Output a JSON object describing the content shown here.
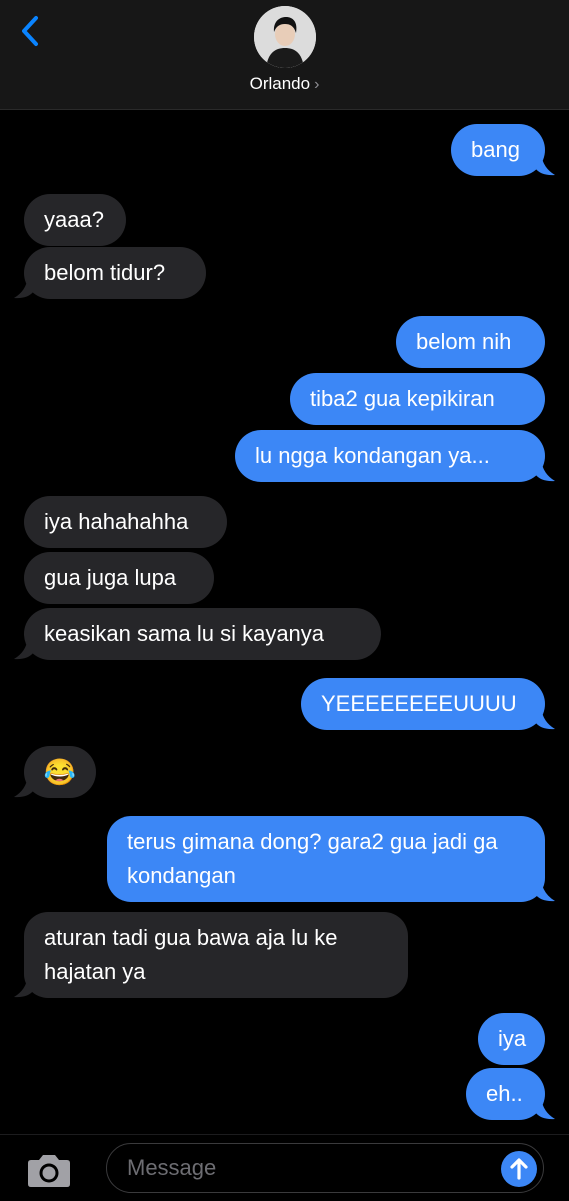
{
  "contact": {
    "name": "Orlando",
    "chevron": "›"
  },
  "messages": [
    {
      "from": "me",
      "text": "bang"
    },
    {
      "from": "them",
      "text": "yaaa?"
    },
    {
      "from": "them",
      "text": "belom tidur?"
    },
    {
      "from": "me",
      "text": "belom nih"
    },
    {
      "from": "me",
      "text": "tiba2 gua kepikiran"
    },
    {
      "from": "me",
      "text": "lu ngga kondangan ya..."
    },
    {
      "from": "them",
      "text": "iya hahahahha"
    },
    {
      "from": "them",
      "text": "gua juga lupa"
    },
    {
      "from": "them",
      "text": "keasikan sama lu si kayanya"
    },
    {
      "from": "me",
      "text": "YEEEEEEEEUUUU"
    },
    {
      "from": "them",
      "text": "😂"
    },
    {
      "from": "me",
      "text": "terus gimana dong? gara2 gua jadi ga kondangan"
    },
    {
      "from": "them",
      "text": "aturan tadi gua bawa aja lu ke hajatan ya"
    },
    {
      "from": "me",
      "text": "iya"
    },
    {
      "from": "me",
      "text": "eh.."
    }
  ],
  "composer": {
    "placeholder": "Message"
  },
  "icons": {
    "back": "back-chevron-icon",
    "camera": "camera-icon",
    "send": "send-arrow-icon"
  },
  "colors": {
    "sent": "#3c87f6",
    "received": "#262629",
    "accent": "#0a84ff"
  }
}
